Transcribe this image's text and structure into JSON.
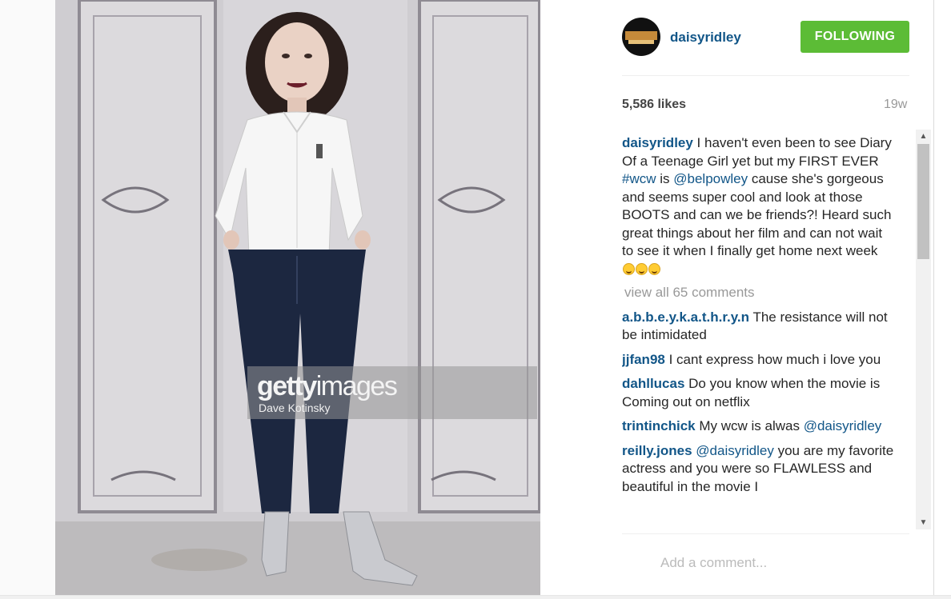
{
  "post": {
    "username": "daisyridley",
    "follow_label": "FOLLOWING",
    "likes": "5,586 likes",
    "timestamp": "19w",
    "photo": {
      "watermark_logo_bold": "getty",
      "watermark_logo_light": "images",
      "watermark_credit": "Dave Kotinsky"
    }
  },
  "caption": {
    "user": "daisyridley",
    "text_1": " I haven't even been to see Diary Of a Teenage Girl yet but my FIRST EVER ",
    "hashtag": "#wcw",
    "text_2": " is ",
    "mention": "@belpowley",
    "text_3": " cause she's gorgeous and seems super cool and look at those BOOTS and can we be friends?! Heard such great things about her film and can not wait to see it when I finally get home next week ",
    "emoji_name": "grinning-face-emoji"
  },
  "view_all_comments": "view all 65 comments",
  "comments": [
    {
      "user": "a.b.b.e.y.k.a.t.h.r.y.n",
      "text": " The resistance will not be intimidated"
    },
    {
      "user": "jjfan98",
      "text": " I cant express how much i love you"
    },
    {
      "user": "dahllucas",
      "text": " Do you know when the movie is Coming out on netflix"
    },
    {
      "user": "trintinchick",
      "text": " My wcw is alwas ",
      "mention": "@daisyridley"
    },
    {
      "user": "reilly.jones",
      "mention": "@daisyridley",
      "text": " you are my favorite actress and you were so FLAWLESS and beautiful in the movie I"
    }
  ],
  "add_comment": {
    "placeholder": "Add a comment..."
  },
  "colors": {
    "link": "#125688",
    "follow_button": "#5cbc36",
    "muted": "#999999"
  }
}
